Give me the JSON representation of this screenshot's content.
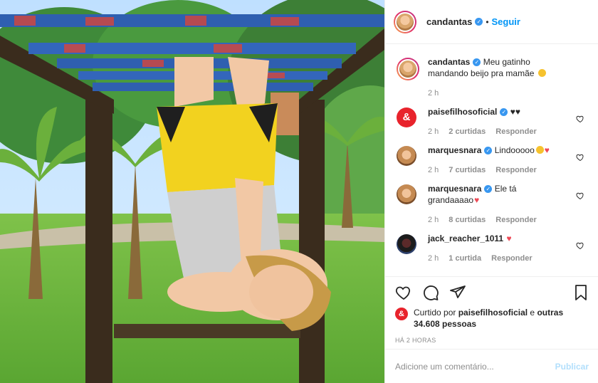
{
  "post": {
    "author": "candantas",
    "follow_label": "Seguir",
    "separator": "•",
    "photo_alt": "Criança pendurada de cabeça para baixo em brinquedo de parque"
  },
  "caption": {
    "username": "candantas",
    "text": "Meu gatinho mandando beijo pra mamãe",
    "time": "2 h"
  },
  "comments": [
    {
      "username": "paisefilhosoficial",
      "text": "♥♥",
      "time": "2 h",
      "likes": "2 curtidas",
      "reply": "Responder",
      "avatar": "brand-logo"
    },
    {
      "username": "marquesnara",
      "text": "Lindooooo",
      "time": "2 h",
      "likes": "7 curtidas",
      "reply": "Responder",
      "avatar": "user-photo"
    },
    {
      "username": "marquesnara",
      "text": "Ele tá grandaaaao",
      "time": "2 h",
      "likes": "8 curtidas",
      "reply": "Responder",
      "avatar": "user-photo"
    },
    {
      "username": "jack_reacher_1011",
      "text": "",
      "time": "2 h",
      "likes": "1 curtida",
      "reply": "Responder",
      "avatar": "user-photo"
    }
  ],
  "likes": {
    "prefix": "Curtido por",
    "by_user": "paisefilhosoficial",
    "middle": "e",
    "others": "outras 34.608 pessoas"
  },
  "timestamp": "HÁ 2 HORAS",
  "add_comment": {
    "placeholder": "Adicione um comentário...",
    "post_label": "Publicar"
  },
  "colors": {
    "link_blue": "#0095f6",
    "verified_blue": "#3897f0",
    "brand_red": "#e8232c",
    "muted_text": "#8e8e8e",
    "disabled_blue": "#b2dffc"
  },
  "icons": [
    "heart-icon",
    "comment-icon",
    "share-icon",
    "bookmark-icon",
    "verified-icon",
    "like-comment-icon"
  ]
}
